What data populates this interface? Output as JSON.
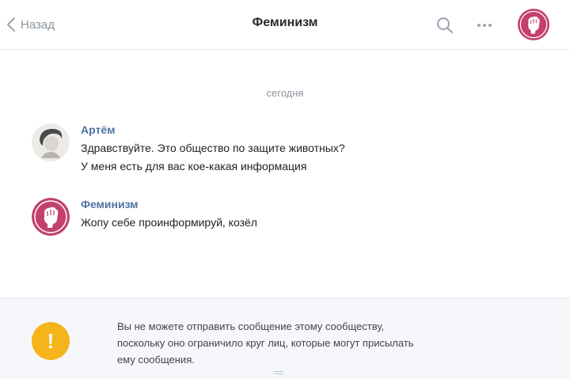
{
  "header": {
    "back_label": "Назад",
    "title": "Феминизм"
  },
  "chat": {
    "date_label": "сегодня",
    "messages": [
      {
        "author": "Артём",
        "lines": [
          "Здравствуйте. Это общество по защите животных?",
          "У меня есть для вас кое-какая информация"
        ]
      },
      {
        "author": "Феминизм",
        "lines": [
          "Жопу себе проинформируй, козёл"
        ]
      }
    ]
  },
  "notice": {
    "lines": [
      "Вы не можете отправить сообщение этому сообществу,",
      "поскольку оно ограничило круг лиц, которые могут присылать",
      "ему сообщения."
    ]
  },
  "colors": {
    "community_avatar": "#c2416b",
    "author_link": "#4f74a3",
    "warning": "#f5b41b"
  }
}
